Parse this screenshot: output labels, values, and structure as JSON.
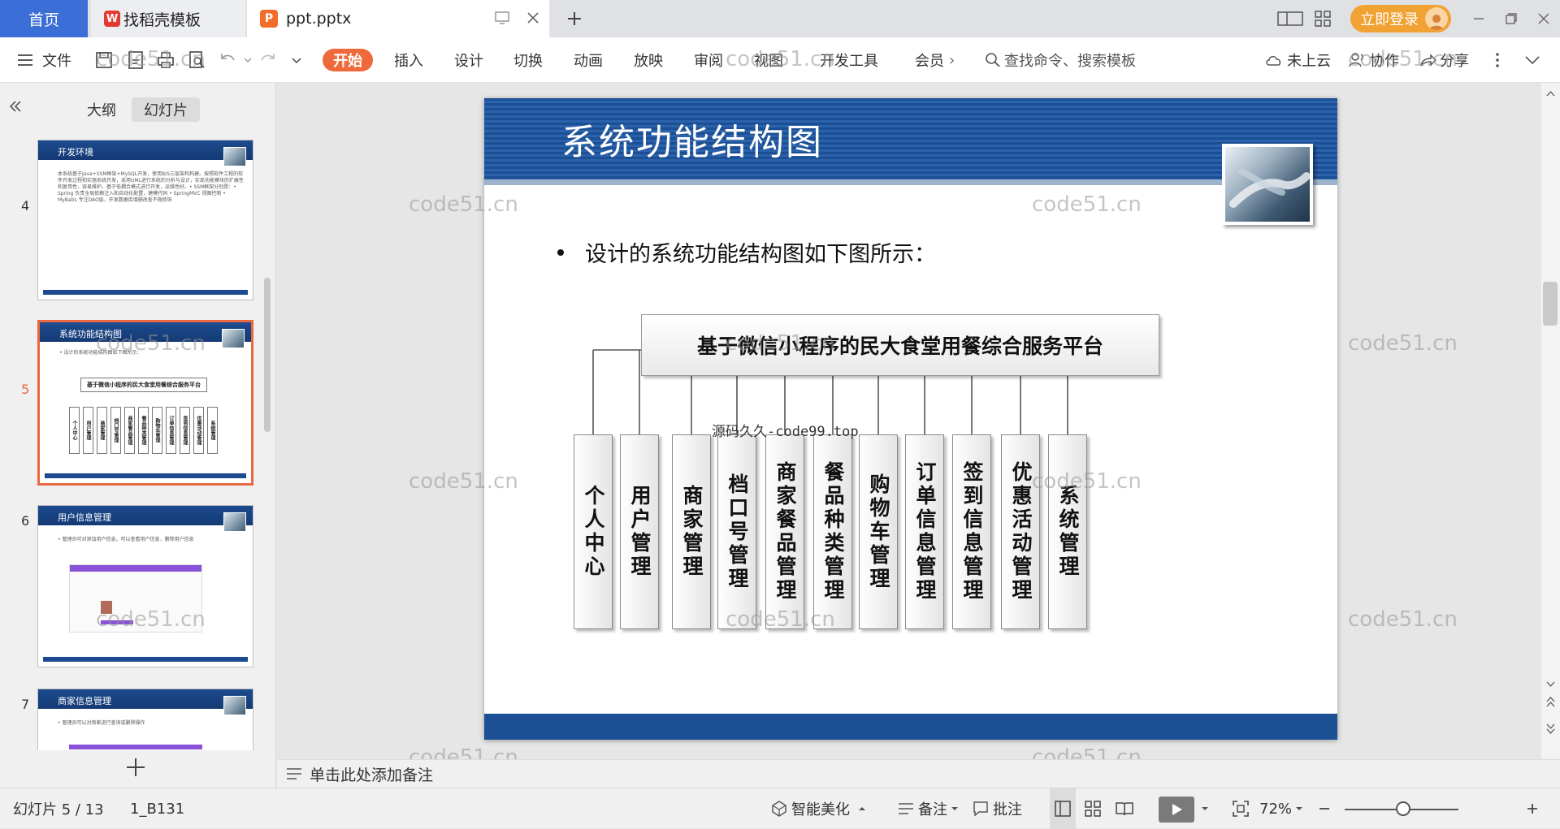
{
  "tabs": {
    "home": "首页",
    "docer": "找稻壳模板",
    "document": "ppt.pptx"
  },
  "header_right": {
    "login": "立即登录"
  },
  "ribbon": {
    "file": "文件",
    "menus": [
      "开始",
      "插入",
      "设计",
      "切换",
      "动画",
      "放映",
      "审阅",
      "视图",
      "开发工具",
      "会员"
    ],
    "more": "›",
    "search_placeholder": "查找命令、搜索模板",
    "cloud": "未上云",
    "collab": "协作",
    "share": "分享"
  },
  "panel": {
    "tabs": {
      "outline": "大纲",
      "slides": "幻灯片"
    },
    "thumbs": [
      {
        "num": "4",
        "title": "开发环境",
        "text": "本系统基于Java+SSM框架+MySQL开发，使用B/S三层架构构建。按照软件工程的软件开发过程和实施系统开发，采用UML进行系统的分析与设计，实现功能模块的扩展性和复用性，容易维护。基于低耦合模式进行开发，运维性好。• SSM框架分别是：• Spring 负责全局依赖注入和自动化配置，建模代码 • SpringMVC 视图控制 • MyBatis 专注DAO层，开发数据库增删改查不做修饰"
      },
      {
        "num": "5",
        "title": "系统功能结构图",
        "text": "• 设计的系统功能结构图如下图所示："
      },
      {
        "num": "6",
        "title": "用户信息管理",
        "text": "• 管理员可对添加用户信息，可以查看用户信息，删除用户信息"
      },
      {
        "num": "7",
        "title": "商家信息管理",
        "text": "• 管理员可以对商家进行查询或删除操作"
      }
    ]
  },
  "slide": {
    "title": "系统功能结构图",
    "bullet": "设计的系统功能结构图如下图所示：",
    "root": "基于微信小程序的民大食堂用餐综合服务平台",
    "modules": [
      "个人中心",
      "用户管理",
      "商家管理",
      "档口号管理",
      "商家餐品管理",
      "餐品种类管理",
      "购物车管理",
      "订单信息管理",
      "签到信息管理",
      "优惠活动管理",
      "系统管理"
    ],
    "watermark": "源码久久-code99.top",
    "colors": {
      "header": "#1c4f94",
      "accent": "#ef6a3b"
    }
  },
  "watermark_text": "code51.cn",
  "notes": "单击此处添加备注",
  "status": {
    "slide_info": "幻灯片 5 / 13",
    "theme": "1_B131",
    "beautify": "智能美化",
    "notes": "备注",
    "comments": "批注",
    "zoom": "72%"
  }
}
